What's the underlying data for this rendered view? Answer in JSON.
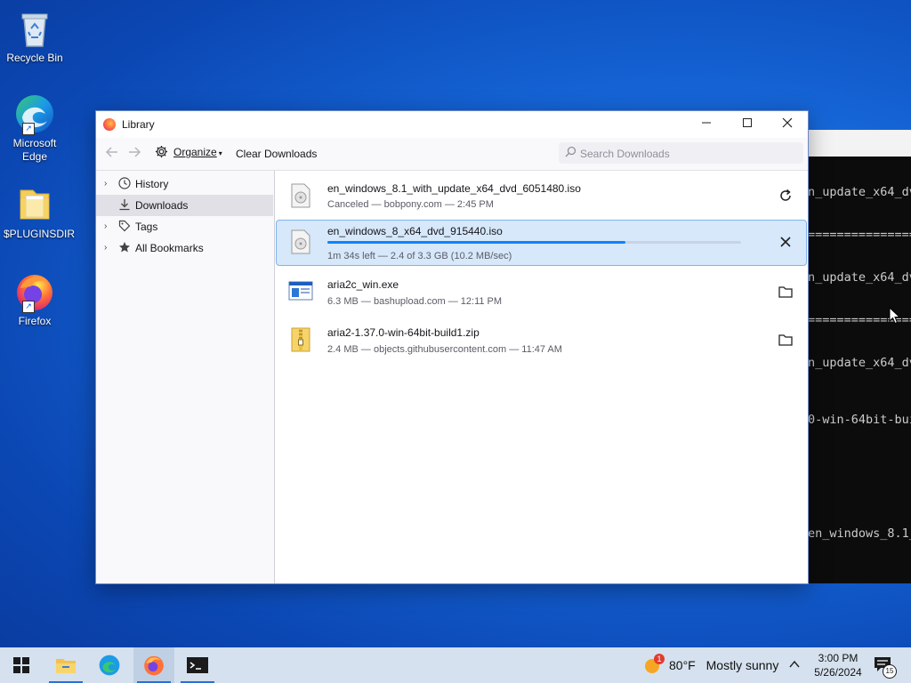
{
  "desktop": {
    "icons": [
      {
        "label": "Recycle Bin"
      },
      {
        "label": "Microsoft Edge"
      },
      {
        "label": "$PLUGINSDIR"
      },
      {
        "label": "Firefox"
      }
    ]
  },
  "terminal": {
    "lines": [
      "",
      "",
      "n_update_x64_dv",
      "",
      "",
      "================",
      "",
      "",
      "n_update_x64_dv",
      "",
      "",
      "================",
      "",
      "",
      "n_update_x64_dv",
      "",
      "",
      "",
      "0-win-64bit-bui",
      "",
      "",
      "",
      "",
      "",
      "",
      "",
      "en_windows_8.1_"
    ]
  },
  "window": {
    "title": "Library",
    "organize_label": "Organize",
    "clear_label": "Clear Downloads",
    "search_placeholder": "Search Downloads"
  },
  "sidebar": {
    "items": [
      {
        "label": "History",
        "icon": "clock-icon"
      },
      {
        "label": "Downloads",
        "icon": "download-icon"
      },
      {
        "label": "Tags",
        "icon": "tag-icon"
      },
      {
        "label": "All Bookmarks",
        "icon": "star-icon"
      }
    ]
  },
  "downloads": [
    {
      "name": "en_windows_8.1_with_update_x64_dvd_6051480.iso",
      "status": "Canceled — bobpony.com — 2:45 PM",
      "action": "retry"
    },
    {
      "name": "en_windows_8_x64_dvd_915440.iso",
      "status": "1m 34s left — 2.4 of 3.3 GB (10.2 MB/sec)",
      "action": "cancel",
      "progress_fraction": 0.72
    },
    {
      "name": "aria2c_win.exe",
      "status": "6.3 MB — bashupload.com — 12:11 PM",
      "action": "show-in-folder"
    },
    {
      "name": "aria2-1.37.0-win-64bit-build1.zip",
      "status": "2.4 MB — objects.githubusercontent.com — 11:47 AM",
      "action": "show-in-folder"
    }
  ],
  "taskbar": {
    "weather_temp": "80°F",
    "weather_text": "Mostly sunny",
    "weather_badge": "1",
    "time": "3:00 PM",
    "date": "5/26/2024",
    "notification_count": "15"
  },
  "colors": {
    "accent": "#0a84ff",
    "selected_row": "#d6e8fa"
  }
}
